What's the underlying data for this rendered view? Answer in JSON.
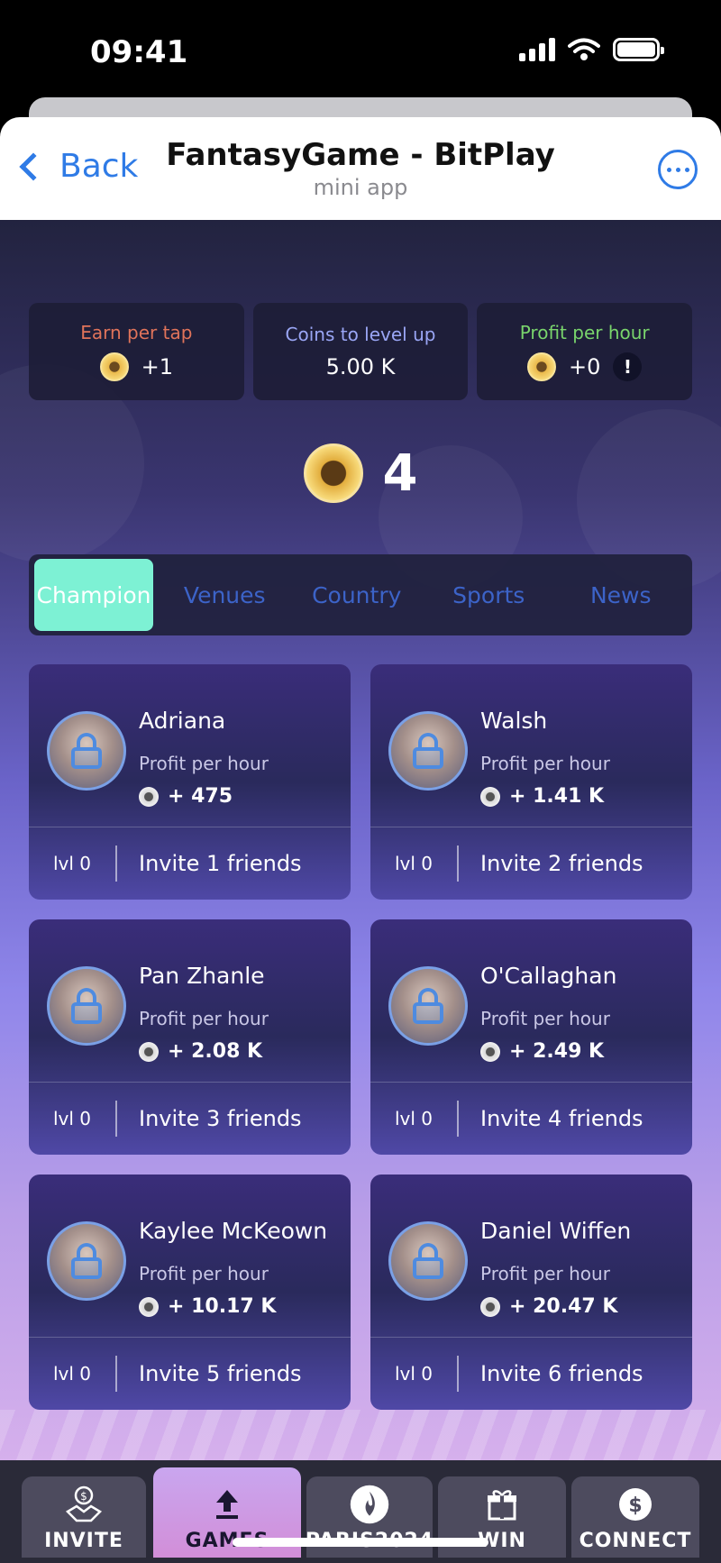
{
  "status_bar": {
    "time": "09:41"
  },
  "header": {
    "back_label": "Back",
    "title": "FantasyGame - BitPlay",
    "subtitle": "mini app"
  },
  "stats": [
    {
      "label": "Earn per tap",
      "value": "+1",
      "label_color": "#e0735a",
      "has_coin": true,
      "has_info": false
    },
    {
      "label": "Coins to level up",
      "value": "5.00 K",
      "label_color": "#9aa6f5",
      "has_coin": false,
      "has_info": false
    },
    {
      "label": "Profit per hour",
      "value": "+0",
      "label_color": "#79d46c",
      "has_coin": true,
      "has_info": true,
      "info_symbol": "!"
    }
  ],
  "balance": "4",
  "tabs": [
    {
      "label": "Champion",
      "active": true
    },
    {
      "label": "Venues",
      "active": false
    },
    {
      "label": "Country",
      "active": false
    },
    {
      "label": "Sports",
      "active": false
    },
    {
      "label": "News",
      "active": false
    }
  ],
  "card_common": {
    "profit_label": "Profit per hour",
    "level": "lvl 0"
  },
  "cards": [
    {
      "name": "Adriana",
      "profit": "+ 475",
      "invite": "Invite 1 friends"
    },
    {
      "name": "Walsh",
      "profit": "+ 1.41 K",
      "invite": "Invite 2 friends"
    },
    {
      "name": "Pan Zhanle",
      "profit": "+ 2.08 K",
      "invite": "Invite 3 friends"
    },
    {
      "name": "O'Callaghan",
      "profit": "+ 2.49 K",
      "invite": "Invite 4 friends"
    },
    {
      "name": "Kaylee McKeown",
      "profit": "+ 10.17 K",
      "invite": "Invite 5 friends"
    },
    {
      "name": "Daniel Wiffen",
      "profit": "+ 20.47 K",
      "invite": "Invite 6 friends"
    }
  ],
  "bottom_nav": [
    {
      "label": "INVITE",
      "icon": "handshake-coin-icon",
      "active": false
    },
    {
      "label": "GAMES",
      "icon": "upload-arrow-icon",
      "active": true
    },
    {
      "label": "PARIS2024",
      "icon": "flame-icon",
      "active": false
    },
    {
      "label": "WIN",
      "icon": "gift-icon",
      "active": false
    },
    {
      "label": "CONNECT",
      "icon": "dollar-coin-icon",
      "active": false
    }
  ],
  "colors": {
    "active_tab": "#7df1d4",
    "tab_text": "#3c63c8",
    "link_blue": "#2f7be6",
    "active_nav": "#c9a6ef"
  }
}
